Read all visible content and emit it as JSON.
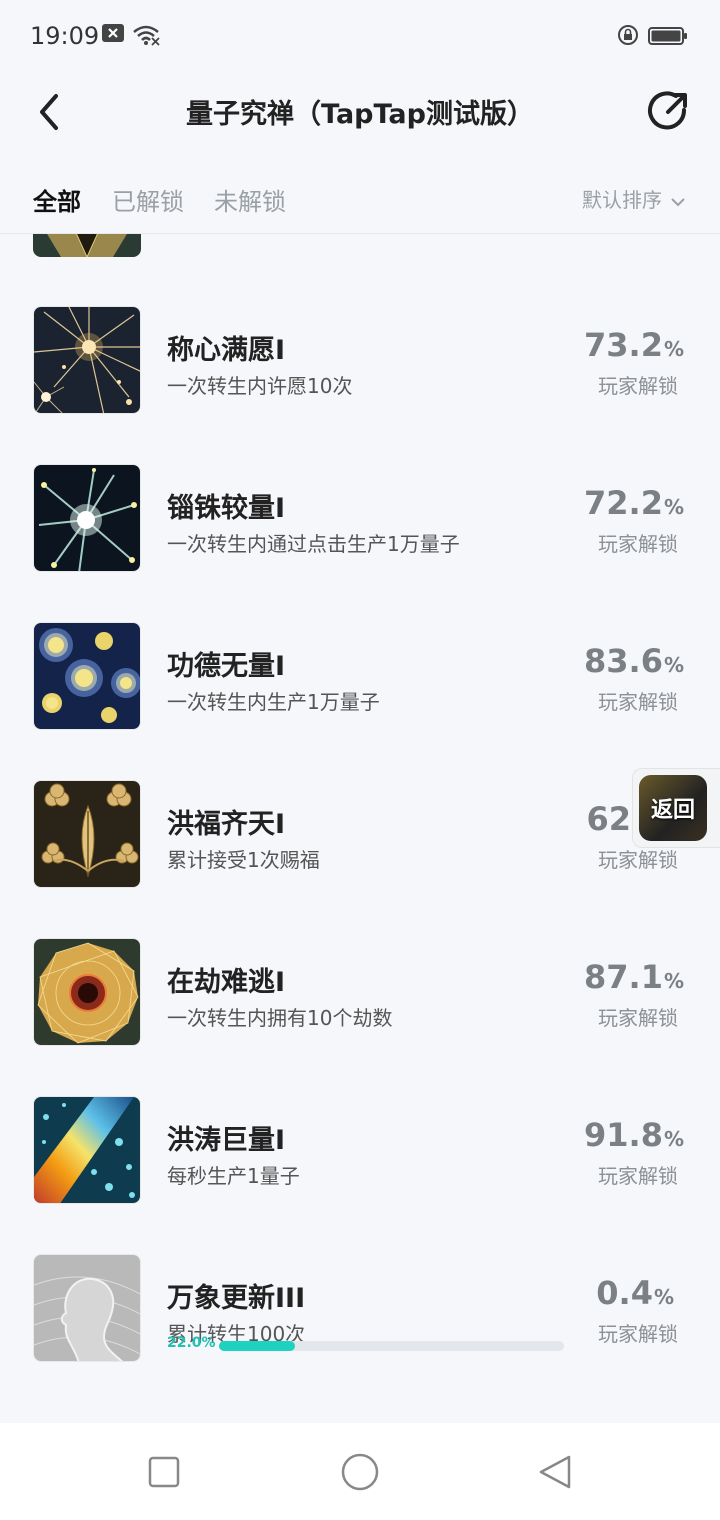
{
  "status_bar": {
    "time": "19:09",
    "icons": [
      "notification-x-icon",
      "wifi-icon",
      "rotation-lock-icon",
      "battery-icon"
    ]
  },
  "header": {
    "title": "量子究禅（TapTap测试版）",
    "back_icon": "back-chevron-icon",
    "share_icon": "share-icon"
  },
  "tabs": [
    {
      "label": "全部",
      "active": true
    },
    {
      "label": "已解锁",
      "active": false
    },
    {
      "label": "未解锁",
      "active": false
    }
  ],
  "sort": {
    "label": "默认排序",
    "icon": "chevron-down-icon"
  },
  "achievements": [
    {
      "name": "称心满愿I",
      "desc": "一次转生内许愿10次",
      "pct": "73.2",
      "unit": "%",
      "pct_label": "玩家解锁",
      "thumb": "starburst"
    },
    {
      "name": "锱铢较量I",
      "desc": "一次转生内通过点击生产1万量子",
      "pct": "72.2",
      "unit": "%",
      "pct_label": "玩家解锁",
      "thumb": "nebula"
    },
    {
      "name": "功德无量I",
      "desc": "一次转生内生产1万量子",
      "pct": "83.6",
      "unit": "%",
      "pct_label": "玩家解锁",
      "thumb": "starry"
    },
    {
      "name": "洪福齐天I",
      "desc": "累计接受1次赐福",
      "pct": "62",
      "unit": "",
      "pct_label": "玩家解锁",
      "thumb": "clover"
    },
    {
      "name": "在劫难逃I",
      "desc": "一次转生内拥有10个劫数",
      "pct": "87.1",
      "unit": "%",
      "pct_label": "玩家解锁",
      "thumb": "mandala"
    },
    {
      "name": "洪涛巨量I",
      "desc": "每秒生产1量子",
      "pct": "91.8",
      "unit": "%",
      "pct_label": "玩家解锁",
      "thumb": "rainbow"
    },
    {
      "name": "万象更新III",
      "desc": "累计转生100次",
      "pct": "0.4",
      "unit": "%",
      "pct_label": "玩家解锁",
      "thumb": "profile",
      "progress": {
        "text": "22.0%",
        "value": 0.22
      }
    }
  ],
  "float_button": {
    "label": "返回"
  },
  "nav_bar": {
    "icons": [
      "recent-apps-icon",
      "home-icon",
      "back-triangle-icon"
    ]
  },
  "colors": {
    "accent": "#1fd1c1",
    "background": "#f5f7fa"
  }
}
